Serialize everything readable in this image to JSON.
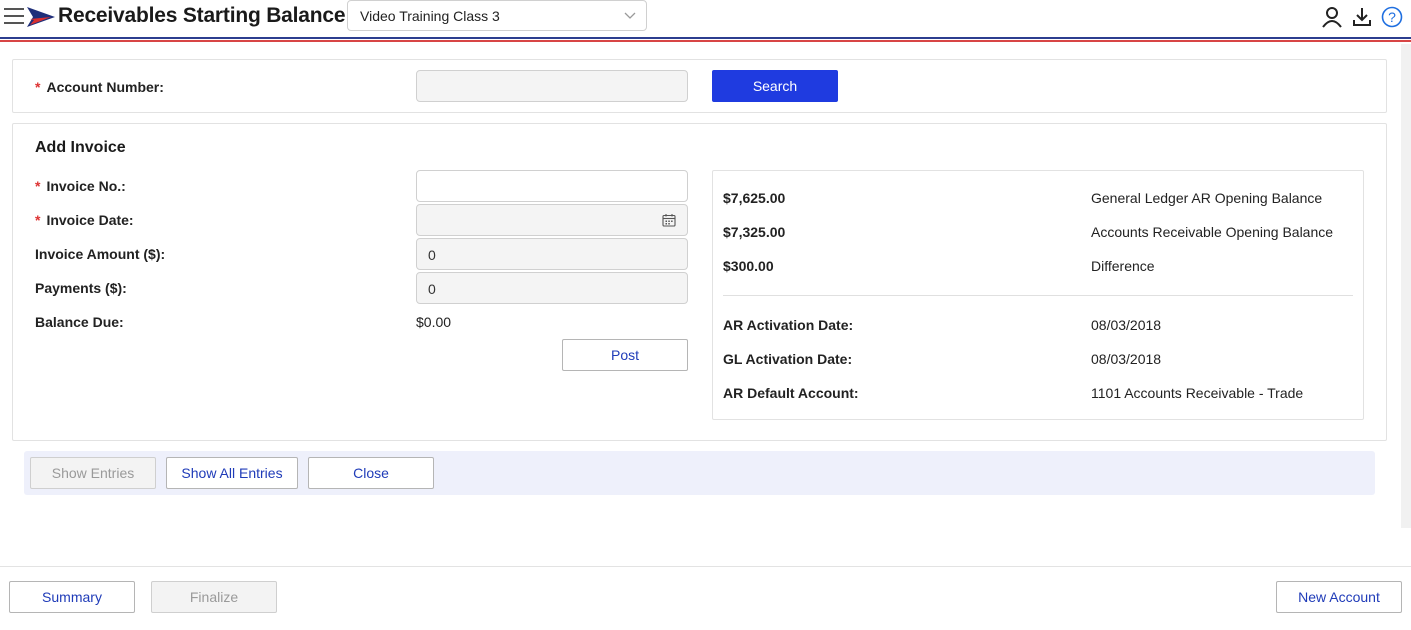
{
  "header": {
    "title": "Receivables Starting Balance",
    "company": "Video Training Class 3",
    "icons": [
      "menu-icon",
      "brand-logo",
      "user-icon",
      "download-icon",
      "help-icon"
    ]
  },
  "account": {
    "label": "Account Number:",
    "value": "",
    "search_label": "Search"
  },
  "invoice": {
    "title": "Add Invoice",
    "invoice_no_label": "Invoice No.:",
    "invoice_no_value": "",
    "invoice_date_label": "Invoice Date:",
    "invoice_date_value": "",
    "amount_label": "Invoice Amount ($):",
    "amount_value": "0",
    "payments_label": "Payments ($):",
    "payments_value": "0",
    "balance_label": "Balance Due:",
    "balance_value": "$0.00",
    "post_label": "Post"
  },
  "summary": {
    "balances": [
      {
        "value": "$7,625.00",
        "label": "General Ledger AR Opening Balance"
      },
      {
        "value": "$7,325.00",
        "label": "Accounts Receivable Opening Balance"
      },
      {
        "value": "$300.00",
        "label": "Difference"
      }
    ],
    "details": [
      {
        "label": "AR Activation Date:",
        "value": "08/03/2018"
      },
      {
        "label": "GL Activation Date:",
        "value": "08/03/2018"
      },
      {
        "label": "AR Default Account:",
        "value": "1101 Accounts Receivable - Trade"
      }
    ]
  },
  "actions": {
    "show_entries": "Show Entries",
    "show_all_entries": "Show All Entries",
    "close": "Close"
  },
  "footer": {
    "summary": "Summary",
    "finalize": "Finalize",
    "new_account": "New Account"
  },
  "colors": {
    "primary": "#1f3be0",
    "link": "#1f3bb8",
    "required": "#dd3333",
    "stripe_blue": "#2c3e8f",
    "stripe_red": "#d84545"
  }
}
